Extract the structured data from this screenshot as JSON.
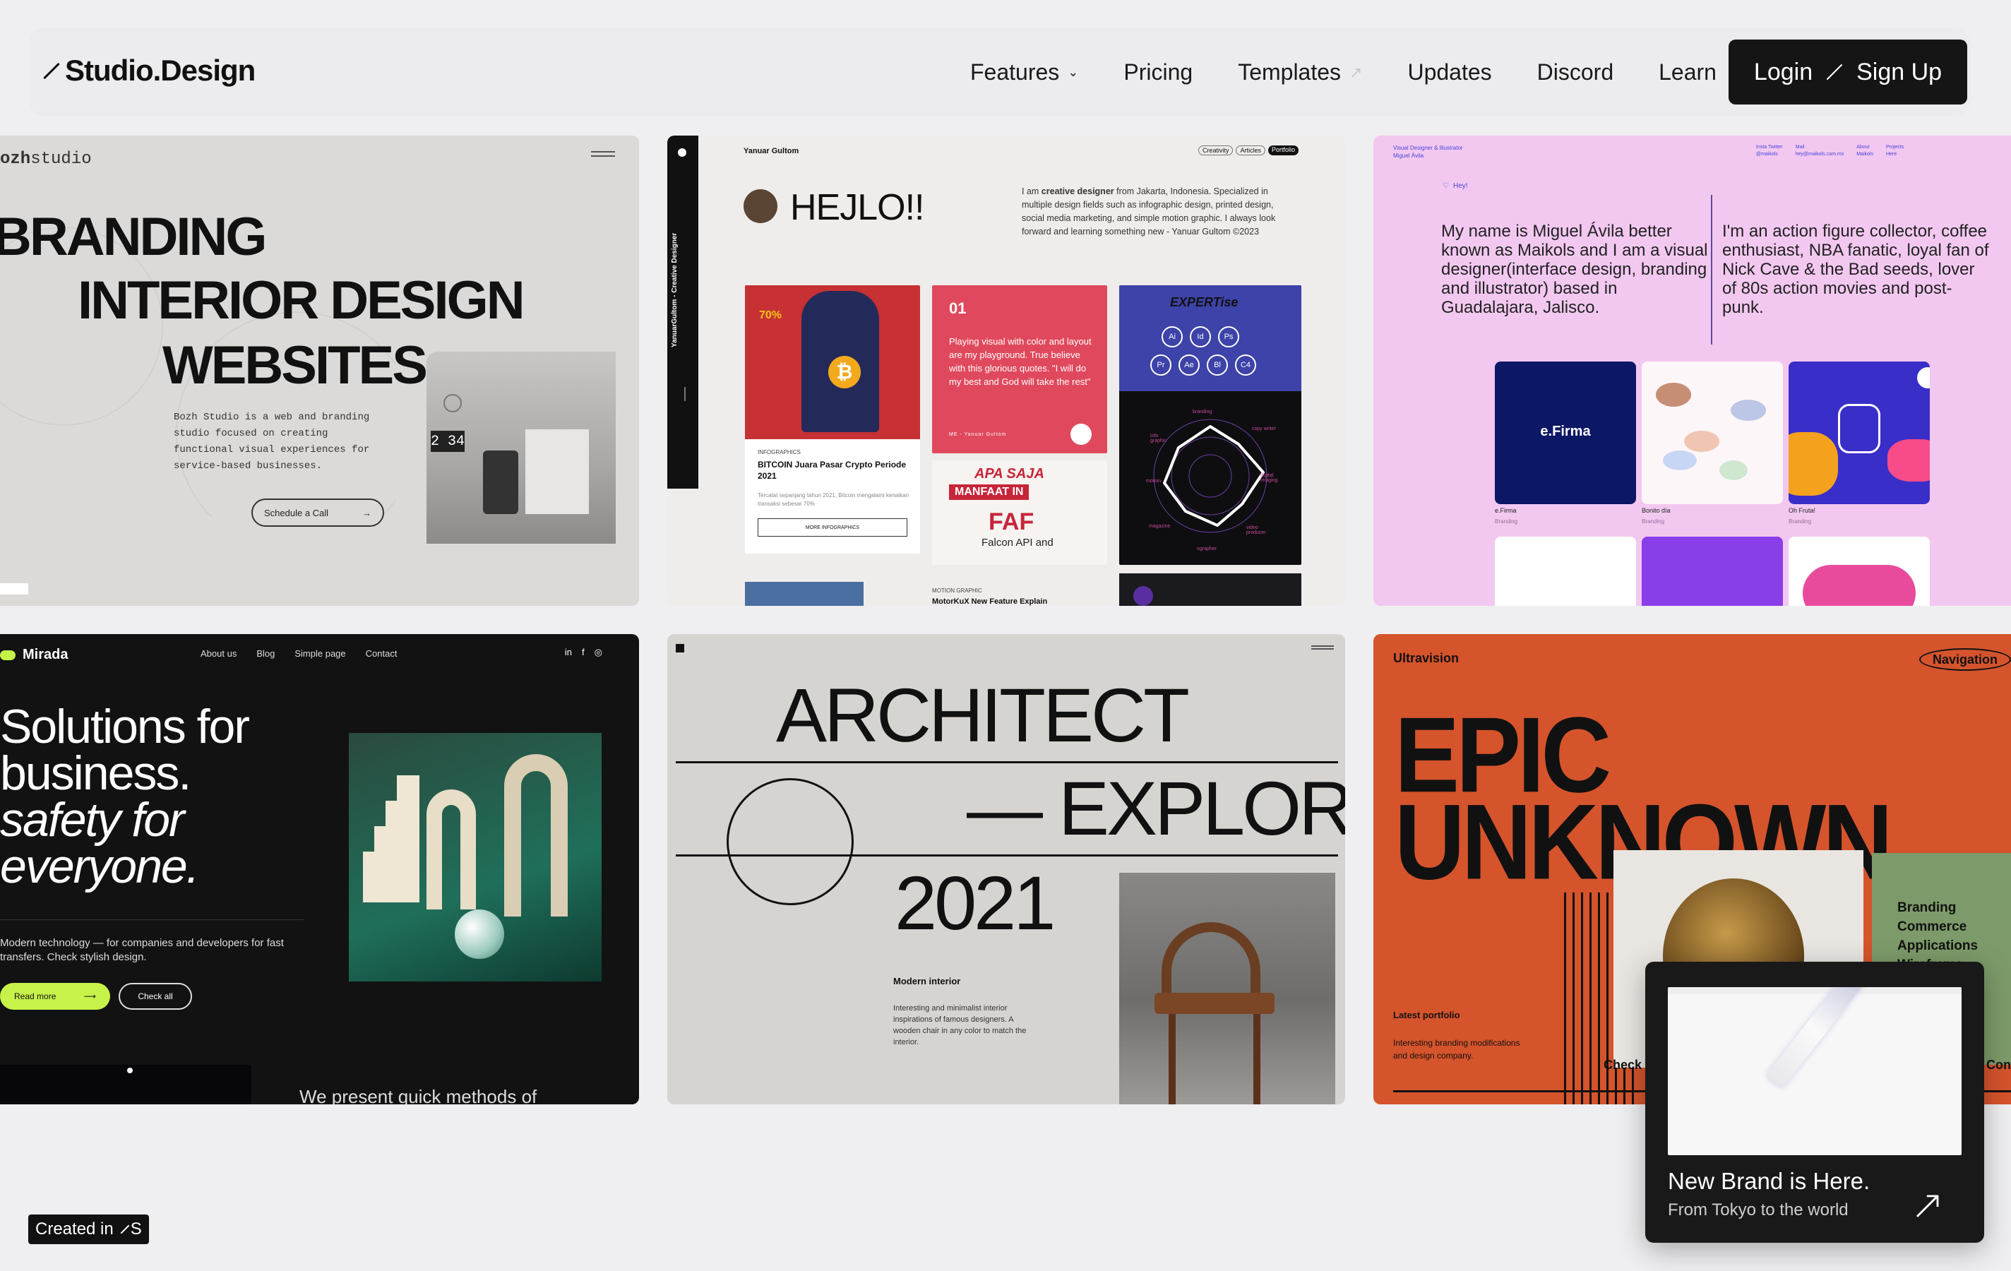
{
  "nav": {
    "logo": "Studio.Design",
    "items": [
      {
        "label": "Features"
      },
      {
        "label": "Pricing"
      },
      {
        "label": "Templates"
      },
      {
        "label": "Updates"
      },
      {
        "label": "Discord"
      },
      {
        "label": "Learn"
      }
    ],
    "login_label": "Login",
    "signup_label": "Sign Up"
  },
  "card1": {
    "brand_bold": "ozh",
    "brand_rest": "studio",
    "line1": "BRANDING",
    "line2": "INTERIOR DESIGN",
    "line3": "WEBSITES",
    "desc": "Bozh Studio is a web and branding studio focused on creating functional visual experiences for service-based businesses.",
    "cta": "Schedule a Call",
    "tv": "2 34"
  },
  "card2": {
    "name": "Yanuar Gultom",
    "tags": [
      "Creativity",
      "Articles",
      "Portfolio"
    ],
    "side": "YanuarGultom - Creative Designer",
    "hello": "HEJLO!!",
    "bio_pre": "I am ",
    "bio_bold": "creative designer",
    "bio_rest": " from Jakarta, Indonesia. Specialized in multiple design fields such as infographic design, printed design, social media marketing, and simple motion graphic. I always look forward and learning something new - Yanuar Gultom ©2023",
    "bitcoin_pct": "70%",
    "bitcoin_cat": "INFOGRAPHICS",
    "bitcoin_title": "BITCOIN Juara Pasar Crypto Periode 2021",
    "bitcoin_sub": "Tercatat sepanjang tahun 2021, Bitcoin mengalami kenaikan transaksi sebesar 70%",
    "more": "MORE INFOGRAPHICS",
    "quote_num": "01",
    "quote": "Playing visual with color and layout are my playground. True believe with this glorious quotes. \"I will do my best and God will take the rest\"",
    "quote_by": "ME - Yanuar Gultom",
    "expert": "EXPERTise",
    "skills": [
      "Ai",
      "Id",
      "Ps",
      "Pr",
      "Ae",
      "Bl",
      "C4"
    ],
    "apa": "APA SAJA",
    "manfaat": "MANFAAT IN",
    "faf": "FAF",
    "falcon": "Falcon API and",
    "motion_cat": "MOTION GRAPHIC",
    "motion_title": "MotorKuX New Feature Explain",
    "radar_labels": [
      "branding",
      "copy writer",
      "digital imaging",
      "video producer",
      "ographer",
      "magazine",
      "motion",
      "info graphic"
    ]
  },
  "card3": {
    "role": "Visual Designer & Illustrator",
    "name": "Miguel Ávila",
    "links": [
      "Insta",
      "Twitter",
      "@maikols",
      "Mail",
      "hey@maikols.com.mx",
      "About",
      "Maikols",
      "Projects",
      "Here"
    ],
    "hey": "Hey!",
    "left_text": "My name is Miguel Ávila better known as Maikols and I am a visual designer(interface design, branding and illustrator) based in Guadalajara, Jalisco.",
    "right_text": "I'm an action figure collector, coffee enthusiast, NBA fanatic, loyal fan of Nick Cave & the Bad seeds, lover of 80s action movies and post-punk.",
    "projects": [
      {
        "title": "e.Firma",
        "cat": "Branding",
        "logo": "e.Firma"
      },
      {
        "title": "Bonito día",
        "cat": "Branding"
      },
      {
        "title": "Oh Fruta!",
        "cat": "Branding"
      }
    ]
  },
  "card4": {
    "logo": "Mirada",
    "links": [
      "About us",
      "Blog",
      "Simple page",
      "Contact"
    ],
    "social": [
      "in",
      "f",
      "◎"
    ],
    "line1": "Solutions for",
    "line2": "business.",
    "line3": "safety for",
    "line4": "everyone.",
    "desc": "Modern technology — for companies and developers for fast transfers. Check stylish design.",
    "read_more": "Read more",
    "check_all": "Check all",
    "bottom": "We present quick methods of"
  },
  "card5": {
    "title1": "ARCHITECT",
    "title2": "— EXPLORE",
    "year": "2021",
    "sub_title": "Modern interior",
    "sub_text": "Interesting and minimalist interior inspirations of famous designers. A wooden chair in any color to match the interior."
  },
  "card6": {
    "brand": "Ultravision",
    "nav_btn": "Navigation",
    "title1": "EPIC",
    "title2": "UNKNOWN",
    "list": [
      "Branding",
      "Commerce",
      "Applications",
      "Wireframe"
    ],
    "latest": "Latest portfolio",
    "desc": "Interesting branding modifications and design company.",
    "check": "Check",
    "con": "Con"
  },
  "popup": {
    "title": "New Brand is Here.",
    "subtitle": "From Tokyo to the world",
    "arrow": "↗"
  },
  "badge": {
    "label": "Created in",
    "mark": "S"
  }
}
